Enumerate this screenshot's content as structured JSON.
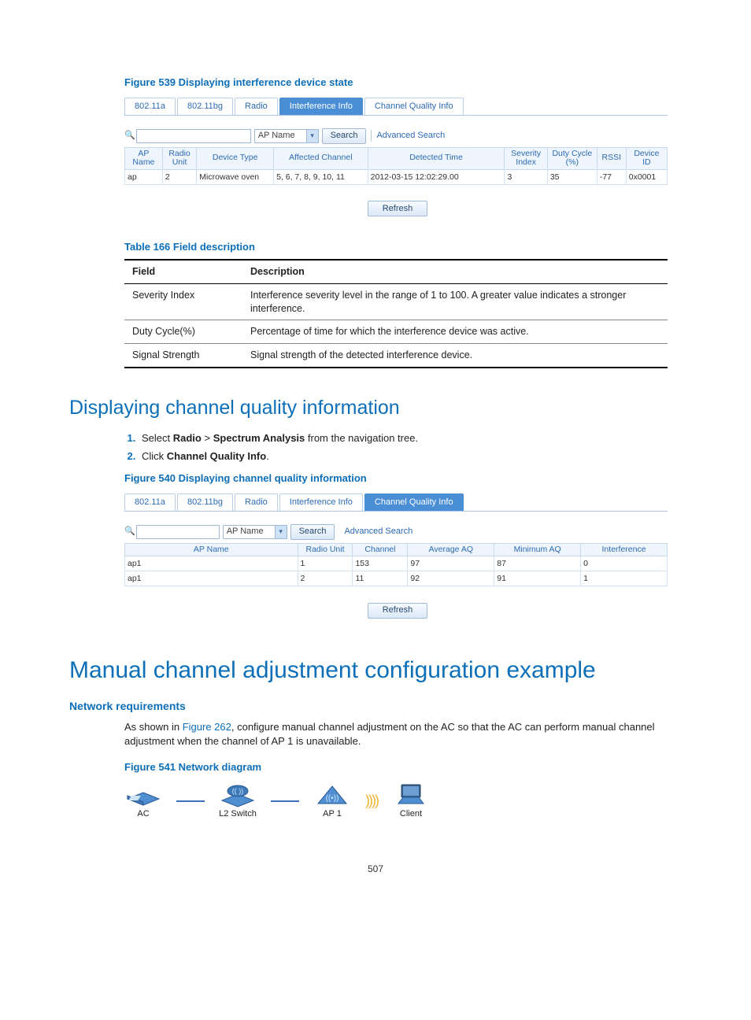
{
  "figure539": {
    "caption": "Figure 539 Displaying interference device state",
    "tabs": [
      "802.11a",
      "802.11bg",
      "Radio",
      "Interference Info",
      "Channel Quality Info"
    ],
    "active_tab_index": 3,
    "search": {
      "select_label": "AP Name",
      "search_btn": "Search",
      "advanced": "Advanced Search"
    },
    "columns": [
      "AP Name",
      "Radio Unit",
      "Device Type",
      "Affected Channel",
      "Detected Time",
      "Severity Index",
      "Duty Cycle (%)",
      "RSSI",
      "Device ID"
    ],
    "rows": [
      {
        "ap_name": "ap",
        "radio_unit": "2",
        "device_type": "Microwave oven",
        "affected_channel": "5, 6, 7, 8, 9, 10, 11",
        "detected_time": "2012-03-15 12:02:29.00",
        "severity_index": "3",
        "duty_cycle": "35",
        "rssi": "-77",
        "device_id": "0x0001"
      }
    ],
    "refresh": "Refresh"
  },
  "table166": {
    "title": "Table 166 Field description",
    "header_field": "Field",
    "header_desc": "Description",
    "rows": [
      {
        "field": "Severity Index",
        "desc": "Interference severity level in the range of 1 to 100. A greater value indicates a stronger interference."
      },
      {
        "field": "Duty Cycle(%)",
        "desc": "Percentage of time for which the interference device was active."
      },
      {
        "field": "Signal Strength",
        "desc": "Signal strength of the detected interference device."
      }
    ]
  },
  "section_channel_quality": {
    "heading": "Displaying channel quality information",
    "steps": [
      {
        "prefix": "Select ",
        "bold1": "Radio",
        "mid": " > ",
        "bold2": "Spectrum Analysis",
        "suffix": " from the navigation tree."
      },
      {
        "prefix": "Click ",
        "bold1": "Channel Quality Info",
        "mid": "",
        "bold2": "",
        "suffix": "."
      }
    ]
  },
  "figure540": {
    "caption": "Figure 540 Displaying channel quality information",
    "tabs": [
      "802.11a",
      "802.11bg",
      "Radio",
      "Interference Info",
      "Channel Quality Info"
    ],
    "active_tab_index": 4,
    "search": {
      "select_label": "AP Name",
      "search_btn": "Search",
      "advanced": "Advanced Search"
    },
    "columns": [
      "AP Name",
      "Radio Unit",
      "Channel",
      "Average AQ",
      "Minimum AQ",
      "Interference"
    ],
    "rows": [
      {
        "ap_name": "ap1",
        "radio_unit": "1",
        "channel": "153",
        "avg_aq": "97",
        "min_aq": "87",
        "interference": "0"
      },
      {
        "ap_name": "ap1",
        "radio_unit": "2",
        "channel": "11",
        "avg_aq": "92",
        "min_aq": "91",
        "interference": "1"
      }
    ],
    "refresh": "Refresh"
  },
  "section_manual": {
    "heading": "Manual channel adjustment configuration example",
    "subheading": "Network requirements",
    "para_prefix": "As shown in ",
    "para_link": "Figure 262",
    "para_suffix": ", configure manual channel adjustment on the AC so that the AC can perform manual channel adjustment when the channel of AP 1 is unavailable."
  },
  "figure541": {
    "caption": "Figure 541 Network diagram",
    "nodes": {
      "ac": "AC",
      "switch": "L2 Switch",
      "ap": "AP 1",
      "client": "Client"
    }
  },
  "page_number": "507"
}
